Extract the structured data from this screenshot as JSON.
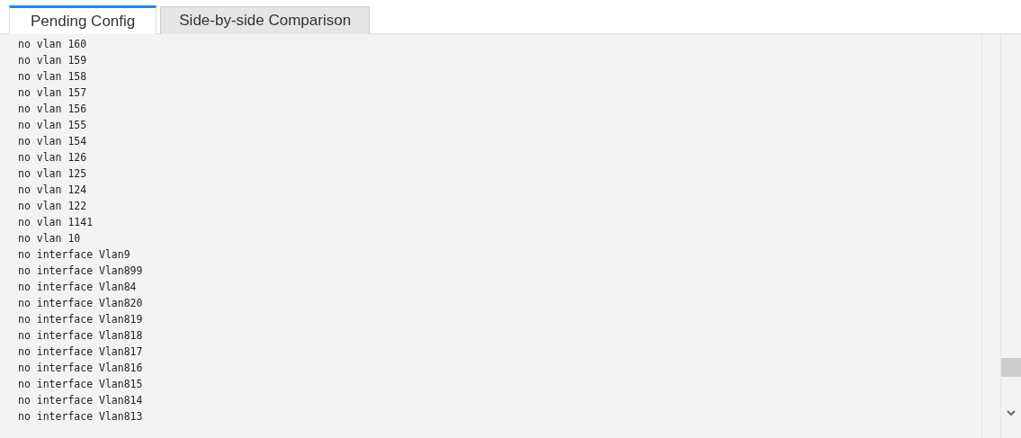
{
  "tabs": [
    {
      "label": "Pending Config",
      "selected": true
    },
    {
      "label": "Side-by-side Comparison",
      "selected": false
    }
  ],
  "config_lines": [
    "no vlan 160",
    "no vlan 159",
    "no vlan 158",
    "no vlan 157",
    "no vlan 156",
    "no vlan 155",
    "no vlan 154",
    "no vlan 126",
    "no vlan 125",
    "no vlan 124",
    "no vlan 122",
    "no vlan 1141",
    "no vlan 10",
    "no interface Vlan9",
    "no interface Vlan899",
    "no interface Vlan84",
    "no interface Vlan820",
    "no interface Vlan819",
    "no interface Vlan818",
    "no interface Vlan817",
    "no interface Vlan816",
    "no interface Vlan815",
    "no interface Vlan814",
    "no interface Vlan813"
  ]
}
